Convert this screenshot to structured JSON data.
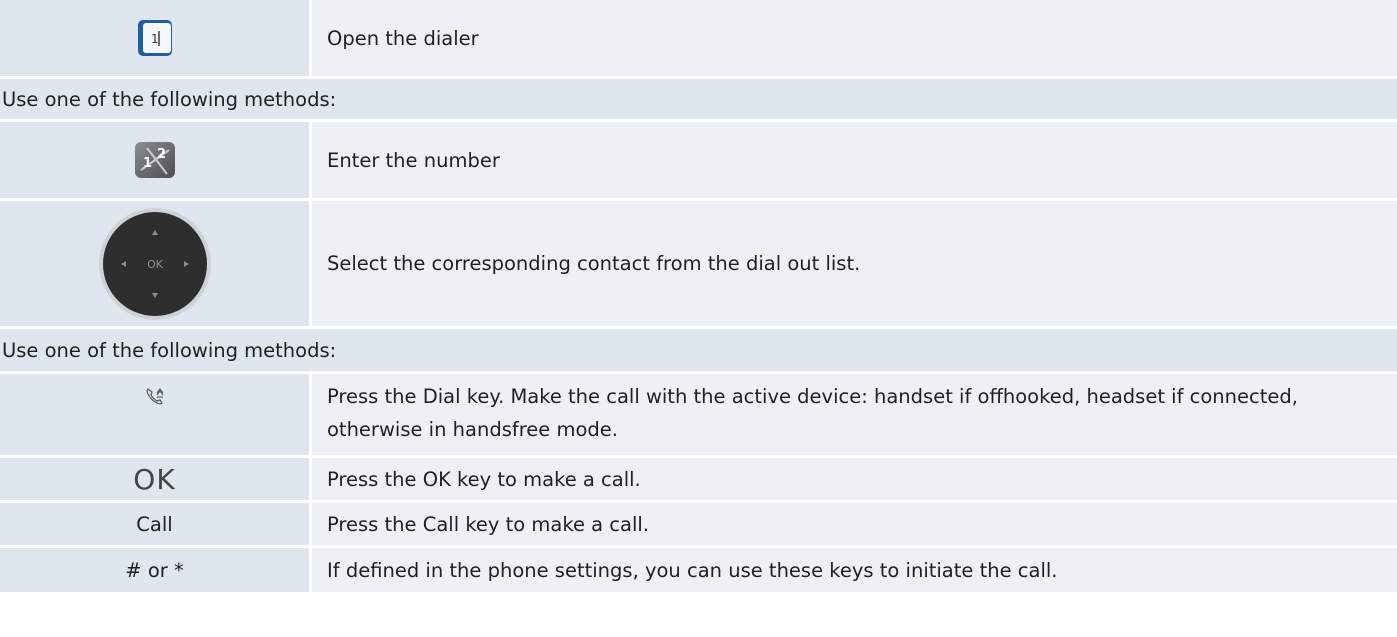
{
  "rows": [
    {
      "type": "step",
      "icon": "dialer-key-icon",
      "description": "Open the dialer"
    },
    {
      "type": "section",
      "text": "Use one of the following methods:"
    },
    {
      "type": "step",
      "icon": "keypad-icon",
      "description": "Enter the number"
    },
    {
      "type": "step",
      "icon": "navigator-ok-icon",
      "icon_text": "OK",
      "description": "Select the corresponding contact from the dial out list."
    },
    {
      "type": "section",
      "text": "Use one of the following methods:"
    },
    {
      "type": "step",
      "icon": "dial-key-icon",
      "description": "Press the Dial key. Make the call with the active device: handset if offhooked, headset if connected, otherwise in handsfree mode."
    },
    {
      "type": "step",
      "icon_text": "OK",
      "description": "Press the OK key to make a call."
    },
    {
      "type": "step",
      "icon_text": "Call",
      "description": "Press the Call key to make a call."
    },
    {
      "type": "step",
      "icon_text": "# or *",
      "description": "If defined in the phone settings, you can use these keys to initiate the call."
    }
  ],
  "dialer_icon_text": "1",
  "keypad_icon_text": "1 2",
  "colors": {
    "icon_cell": "#dfe6ef",
    "desc_cell": "#edf0f5",
    "dialer_blue": "#1f5f9f",
    "navigator_dark": "#2e2e2e"
  }
}
